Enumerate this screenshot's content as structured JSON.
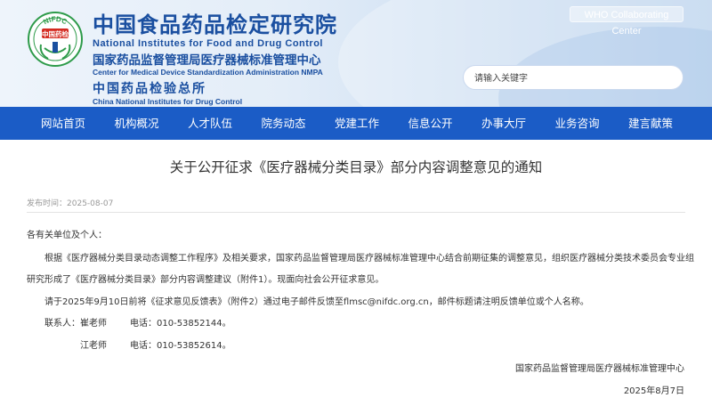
{
  "header": {
    "logo_text": "NIFDC",
    "logo_seal_text": "中国药检",
    "title_cn": "中国食品药品检定研究院",
    "title_en": "National Institutes for Food and Drug Control",
    "sub_cn": "国家药品监督管理局医疗器械标准管理中心",
    "sub_en": "Center for Medical Device Standardization Administration NMPA",
    "sub2_cn": "中国药品检验总所",
    "sub2_en": "China National Institutes for Drug Control",
    "who_label": "WHO Collaborating Center",
    "search_placeholder": "请输入关键字"
  },
  "nav": {
    "items": [
      "网站首页",
      "机构概况",
      "人才队伍",
      "院务动态",
      "党建工作",
      "信息公开",
      "办事大厅",
      "业务咨询",
      "建言献策"
    ]
  },
  "article": {
    "title": "关于公开征求《医疗器械分类目录》部分内容调整意见的通知",
    "publish_label": "发布时间：",
    "publish_date": "2025-08-07",
    "greeting": "各有关单位及个人：",
    "para1_line1": "根据《医疗器械分类目录动态调整工作程序》及相关要求，国家药品监督管理局医疗器械标准管理中心结合前期征集的调整意见，组织医疗器械分类技术委员会专业组",
    "para1_line2": "研究形成了《医疗器械分类目录》部分内容调整建议（附件1）。现面向社会公开征求意见。",
    "para2": "请于2025年9月10日前将《征求意见反馈表》（附件2）通过电子邮件反馈至flmsc@nifdc.org.cn，邮件标题请注明反馈单位或个人名称。",
    "contact_label": "联系人：",
    "contact1_name": "崔老师",
    "contact1_phone": "电话：010-53852144。",
    "contact2_name": "江老师",
    "contact2_phone": "电话：010-53852614。",
    "signature": "国家药品监督管理局医疗器械标准管理中心",
    "sign_date": "2025年8月7日"
  },
  "colors": {
    "nav_bg": "#1b5cc6",
    "brand_blue": "#1a4fa0",
    "logo_green": "#2e9b4a",
    "logo_red": "#d42a20"
  }
}
